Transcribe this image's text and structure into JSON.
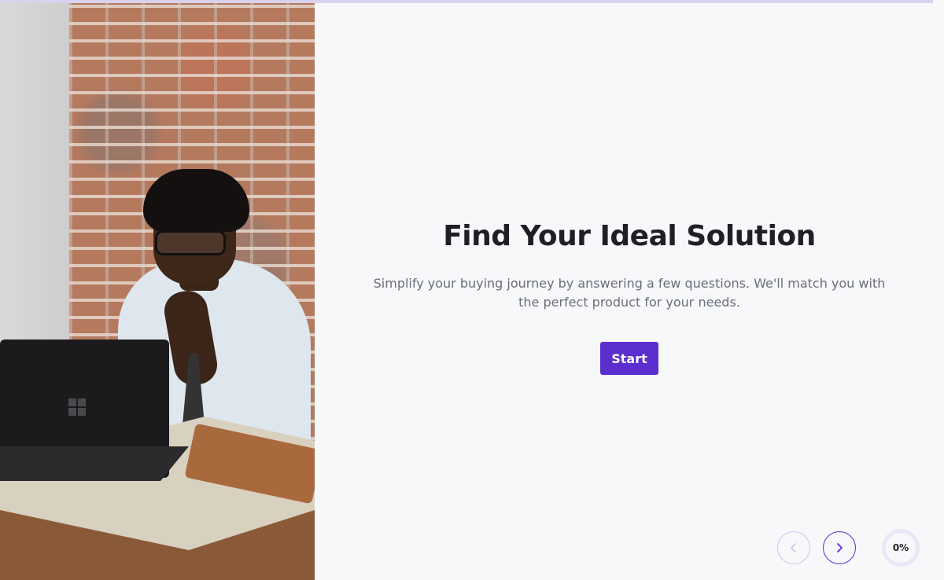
{
  "hero": {
    "title": "Find Your Ideal Solution",
    "subtitle": "Simplify your buying journey by answering a few questions. We'll match you with the perfect product for your needs.",
    "start_label": "Start"
  },
  "navigation": {
    "prev_icon": "chevron-left-icon",
    "next_icon": "chevron-right-icon"
  },
  "progress": {
    "percent_label": "0%",
    "value": 0
  },
  "colors": {
    "accent": "#5b2ecf",
    "accent_light": "#cfc4ee",
    "background": "#f7f8fa",
    "title": "#1f1f24",
    "subtitle": "#6b6c7a"
  }
}
